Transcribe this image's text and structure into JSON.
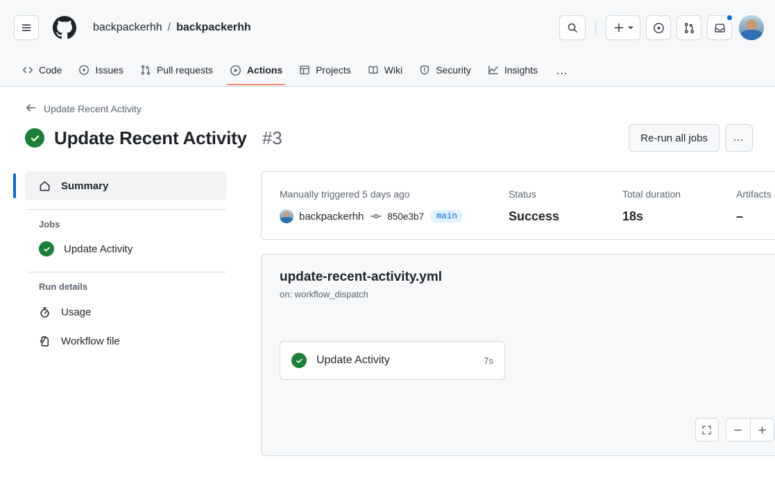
{
  "header": {
    "menu_icon": "hamburger-menu-icon",
    "logo_icon": "github-logo-icon",
    "owner": "backpackerhh",
    "separator": "/",
    "repo": "backpackerhh",
    "search_icon": "search-icon",
    "create_icon": "plus-icon",
    "create_caret_icon": "chevron-down-icon",
    "issues_icon": "issue-opened-icon",
    "pull_requests_icon": "git-pull-request-icon",
    "notifications_icon": "inbox-icon",
    "avatar": "user-avatar",
    "has_unread_notifications": true,
    "notification_dot_color": "#0969da"
  },
  "repo_nav": {
    "items": [
      {
        "label": "Code",
        "icon": "code-icon",
        "active": false
      },
      {
        "label": "Issues",
        "icon": "issue-opened-icon",
        "active": false
      },
      {
        "label": "Pull requests",
        "icon": "git-pull-request-icon",
        "active": false
      },
      {
        "label": "Actions",
        "icon": "play-icon",
        "active": true
      },
      {
        "label": "Projects",
        "icon": "table-icon",
        "active": false
      },
      {
        "label": "Wiki",
        "icon": "book-icon",
        "active": false
      },
      {
        "label": "Security",
        "icon": "shield-icon",
        "active": false
      },
      {
        "label": "Insights",
        "icon": "graph-icon",
        "active": false
      }
    ],
    "overflow_label": "…",
    "active_underline_color": "#fd8c73"
  },
  "run": {
    "back_label": "Update Recent Activity",
    "back_icon": "arrow-left-icon",
    "status_icon": "check-circle-fill-icon",
    "status_color": "#1a7f37",
    "title": "Update Recent Activity",
    "number": "#3",
    "rerun_label": "Re-run all jobs",
    "kebab_label": "…"
  },
  "sidebar": {
    "summary": {
      "label": "Summary",
      "icon": "home-icon",
      "selected": true
    },
    "jobs_heading": "Jobs",
    "jobs": [
      {
        "label": "Update Activity",
        "status_icon": "check-circle-fill-icon"
      }
    ],
    "run_details_heading": "Run details",
    "details": [
      {
        "label": "Usage",
        "icon": "stopwatch-icon"
      },
      {
        "label": "Workflow file",
        "icon": "file-code-icon"
      }
    ],
    "selected_bar_color": "#0969da"
  },
  "summary": {
    "trigger_text": "Manually triggered 5 days ago",
    "actor": "backpackerhh",
    "actor_avatar": "user-avatar",
    "commit_icon": "git-commit-icon",
    "commit_sha": "850e3b7",
    "branch": "main",
    "stats": [
      {
        "label": "Status",
        "value": "Success"
      },
      {
        "label": "Total duration",
        "value": "18s"
      },
      {
        "label": "Artifacts",
        "value": "–"
      }
    ]
  },
  "graph": {
    "workflow_file": "update-recent-activity.yml",
    "trigger": "on: workflow_dispatch",
    "node": {
      "name": "Update Activity",
      "duration": "7s",
      "status_icon": "check-circle-fill-icon"
    },
    "controls": {
      "fit_icon": "fit-screen-icon",
      "zoom_out_icon": "minus-icon",
      "zoom_in_icon": "plus-icon"
    }
  }
}
